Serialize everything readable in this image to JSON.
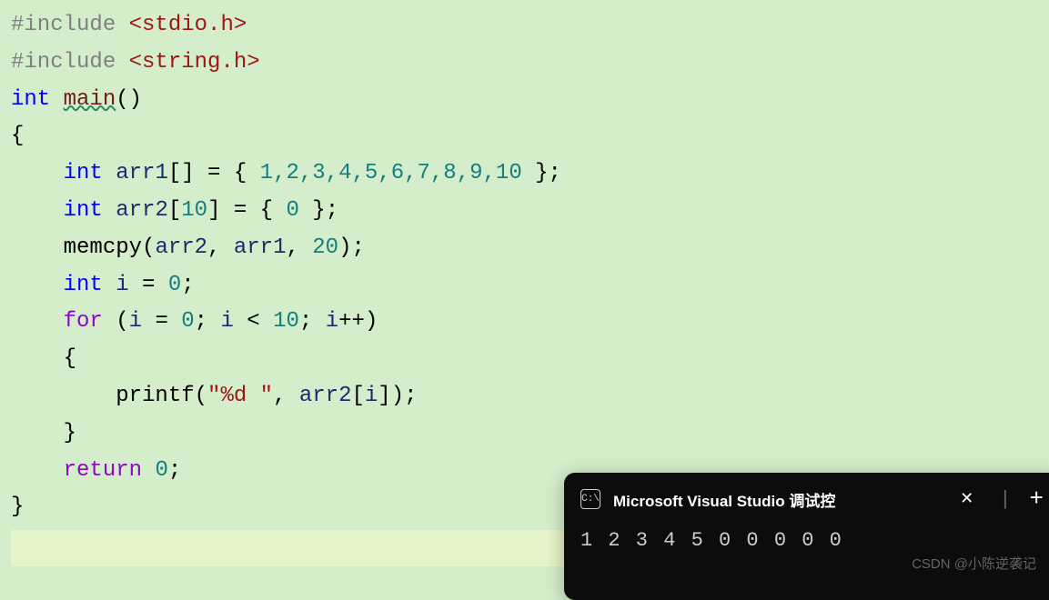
{
  "code": {
    "line1_preproc": "#include ",
    "line1_path": "<stdio.h>",
    "line2_preproc": "#include ",
    "line2_path": "<string.h>",
    "line3_type": "int",
    "line3_name": "main",
    "line3_parens": "()",
    "line5_type": "int",
    "line5_id": "arr1",
    "line5_brackets": "[] = { ",
    "line5_nums": "1,2,3,4,5,6,7,8,9,10",
    "line5_end": " };",
    "line6_type": "int",
    "line6_id": "arr2",
    "line6_brackets": "[",
    "line6_size": "10",
    "line6_mid": "] = { ",
    "line6_zero": "0",
    "line6_end": " };",
    "line7_func": "memcpy",
    "line7_args_open": "(",
    "line7_arg1": "arr2",
    "line7_sep1": ", ",
    "line7_arg2": "arr1",
    "line7_sep2": ", ",
    "line7_arg3": "20",
    "line7_close": ");",
    "line8_type": "int",
    "line8_id": "i",
    "line8_eq": " = ",
    "line8_val": "0",
    "line8_semi": ";",
    "line9_for": "for",
    "line9_open": " (",
    "line9_i1": "i",
    "line9_eq": " = ",
    "line9_z1": "0",
    "line9_s1": "; ",
    "line9_i2": "i",
    "line9_lt": " < ",
    "line9_ten": "10",
    "line9_s2": "; ",
    "line9_i3": "i",
    "line9_inc": "++)",
    "line11_func": "printf",
    "line11_open": "(",
    "line11_str": "\"%d \"",
    "line11_sep": ", ",
    "line11_arr": "arr2",
    "line11_bopen": "[",
    "line11_i": "i",
    "line11_close": "]);",
    "line13_return": "return",
    "line13_val": "0",
    "line13_semi": ";",
    "brace_open": "{",
    "brace_close": "}"
  },
  "terminal": {
    "title": "Microsoft Visual Studio 调试控",
    "output": "1 2 3 4 5 0 0 0 0 0",
    "icon_text": "C:\\"
  },
  "watermark": "CSDN @小陈逆袭记"
}
